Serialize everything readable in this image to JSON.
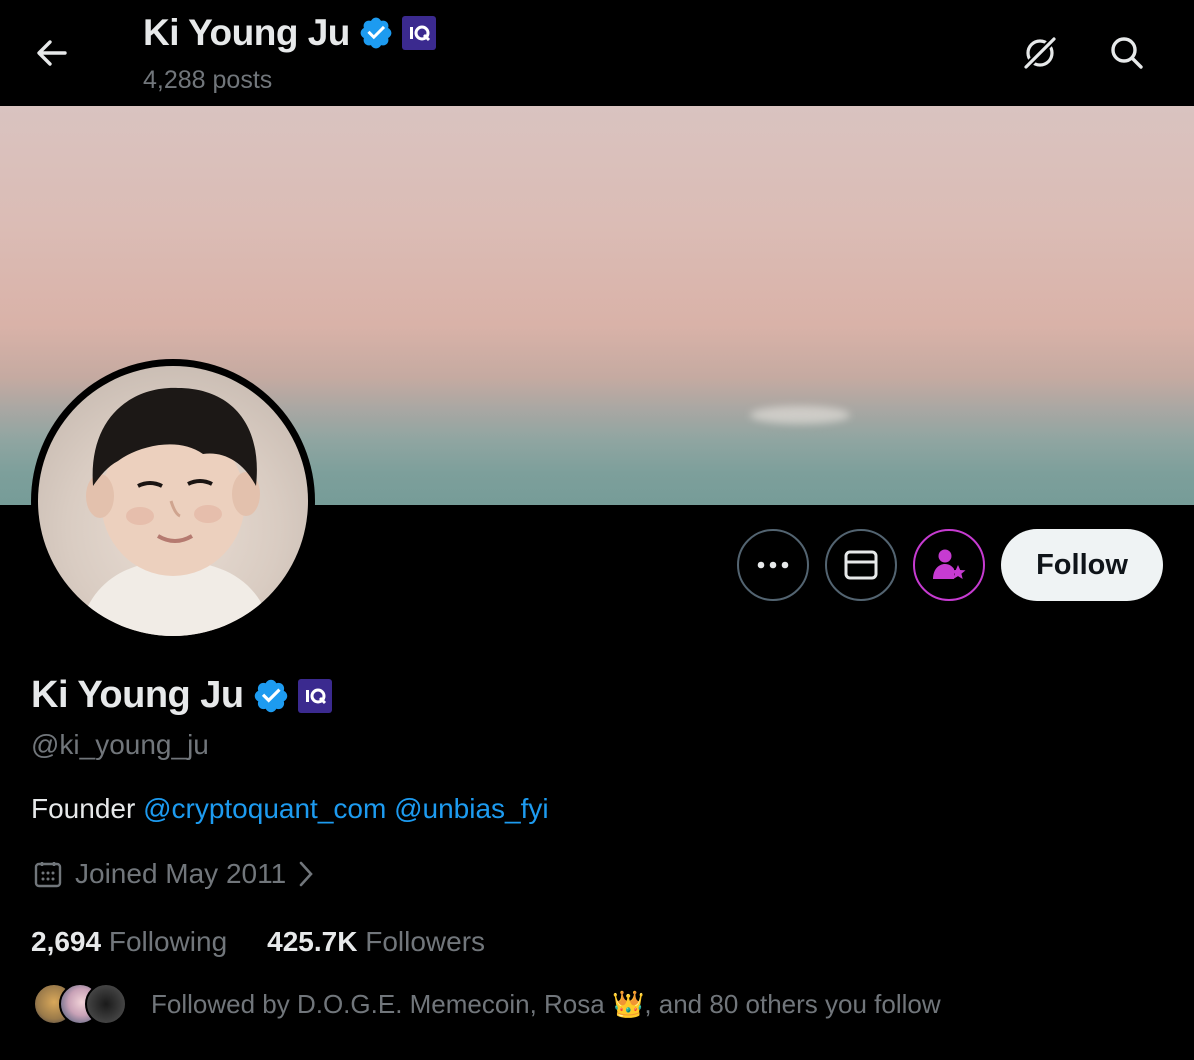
{
  "header": {
    "title": "Ki Young Ju",
    "posts_count": "4,288 posts",
    "back_icon": "arrow-left-icon",
    "grok_icon": "grok-slash-icon",
    "search_icon": "search-icon"
  },
  "profile": {
    "name": "Ki Young Ju",
    "handle": "@ki_young_ju",
    "bio_prefix": "Founder ",
    "bio_link_1": "@cryptoquant_com",
    "bio_link_2": "@unbias_fyi",
    "joined": "Joined May 2011",
    "following_count": "2,694",
    "following_label": "Following",
    "followers_count": "425.7K",
    "followers_label": "Followers",
    "followed_by": "Followed by D.O.G.E. Memecoin, Rosa 👑, and 80 others you follow"
  },
  "actions": {
    "more_icon": "more-icon",
    "message_icon": "envelope-icon",
    "subscribe_icon": "subscribe-person-star-icon",
    "follow_label": "Follow"
  },
  "colors": {
    "background": "#000000",
    "link": "#1d9bf0",
    "muted": "#71767b",
    "verified": "#1d9bf0",
    "subscribe_accent": "#c63bd1",
    "affiliate_badge": "#3b2a8f"
  }
}
